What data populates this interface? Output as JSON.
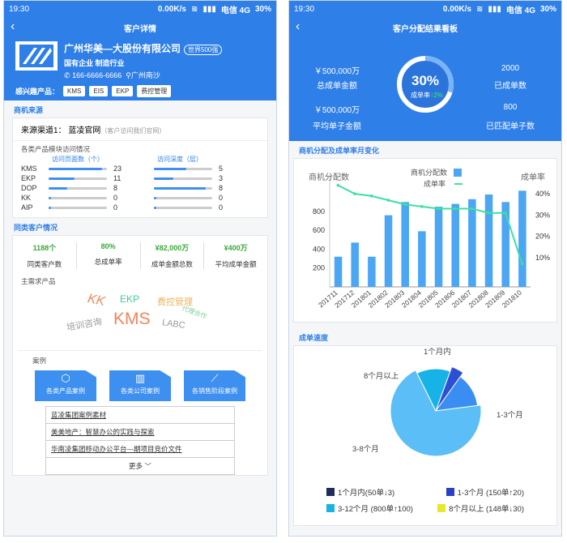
{
  "left": {
    "status": {
      "time": "19:30",
      "speed": "0.00K/s",
      "carrier": "电信 4G",
      "battery": "30%"
    },
    "nav_title": "客户详情",
    "company": {
      "name": "广州华美—大股份有限公司",
      "badge": "世界500强",
      "meta": "国有企业  制造行业",
      "phone": "166-6666-6666",
      "location": "广州南沙",
      "interest_label": "感兴趣产品：",
      "products": [
        "KMS",
        "EIS",
        "EKP",
        "费控管理"
      ]
    },
    "source": {
      "title": "商机来源",
      "channel": "来源渠道1：  蓝凌官网",
      "channel_note": "（客户访问我们官网）",
      "visit_title": "各类产品模块访问情况",
      "pages_head": "访问页面数（个）",
      "depth_head": "访问深度（层）",
      "rows": [
        {
          "name": "KMS",
          "pages": 23,
          "depth": 5
        },
        {
          "name": "EKP",
          "pages": 11,
          "depth": 3
        },
        {
          "name": "DOP",
          "pages": 8,
          "depth": 8
        },
        {
          "name": "KK",
          "pages": 0,
          "depth": 0
        },
        {
          "name": "AIP",
          "pages": 0,
          "depth": 0
        }
      ]
    },
    "similar": {
      "title": "同类客户情况",
      "stats": [
        {
          "value": "1188个",
          "label": "同类客户数"
        },
        {
          "value": "80%",
          "label": "总成单率"
        },
        {
          "value": "¥82,000万",
          "label": "成单金额总数"
        },
        {
          "value": "¥400万",
          "label": "平均成单金额"
        }
      ],
      "demand_label": "主需求产品",
      "cloud": [
        "KK",
        "EKP",
        "费控管理",
        "KMS",
        "培训咨询",
        "LABC",
        "代理合作"
      ]
    },
    "cases": {
      "title": "案例",
      "buttons": [
        "各类产品案例",
        "各类公司案例",
        "各销售阶段案例"
      ],
      "items": [
        "蓝凌集团案例素材",
        "美美地产：智慧办公的实践与探索",
        "华南凌集团移动办公平台—期项目竞价文件"
      ],
      "more": "更多"
    }
  },
  "right": {
    "status": {
      "time": "19:30",
      "speed": "0.00K/s",
      "carrier": "电信 4G",
      "battery": "30%"
    },
    "nav_title": "客户分配结果看板",
    "hero": {
      "total_amount": "￥500,000万",
      "total_amount_label": "总成单金额",
      "avg_amount": "￥500,000万",
      "avg_amount_label": "平均单子金额",
      "deals": "2000",
      "deals_label": "已成单数",
      "matched": "800",
      "matched_label": "已匹配单子数",
      "rate": "30%",
      "rate_label": "成单率",
      "rate_change": "↑2%"
    },
    "trend_title": "商机分配及成单率月变化",
    "speed_title": "成单速度"
  },
  "chart_data": [
    {
      "type": "bar",
      "title": "商机分配及成单率月变化",
      "ylabel": "商机分配数",
      "y2label": "成单率",
      "categories": [
        "201711",
        "201712",
        "201801",
        "201802",
        "201803",
        "201804",
        "201805",
        "201806",
        "201807",
        "201808",
        "201809",
        "201810"
      ],
      "series": [
        {
          "name": "商机分配数",
          "type": "bar",
          "values": [
            320,
            470,
            320,
            760,
            900,
            590,
            850,
            880,
            930,
            980,
            900,
            1020
          ]
        },
        {
          "name": "成单率",
          "type": "line",
          "values": [
            44,
            40,
            39,
            37,
            35,
            34,
            33,
            33,
            33,
            31,
            31,
            7
          ]
        }
      ],
      "ylim": [
        0,
        1100
      ],
      "y_ticks": [
        200,
        400,
        600,
        800
      ],
      "y2_ticks": [
        "10%",
        "20%",
        "30%",
        "40%"
      ]
    },
    {
      "type": "pie",
      "title": "成单速度",
      "slices": [
        {
          "label": "1个月内",
          "value": 50,
          "change": "↓3"
        },
        {
          "label": "1-3个月",
          "value": 150,
          "change": "↑20"
        },
        {
          "label": "3-8个月",
          "value": 800,
          "change": "↑100"
        },
        {
          "label": "8个月以上",
          "value": 148,
          "change": "↓30"
        }
      ],
      "legend": [
        "1个月内(50单↓3)",
        "1-3个月  (150单↑20)",
        "3-12个月  (800单↑100)",
        "8个月以上  (148单↓30)"
      ],
      "colors": [
        "#1f2b5b",
        "#2a3fc7",
        "#17b3e6",
        "#e8e82a"
      ]
    }
  ]
}
